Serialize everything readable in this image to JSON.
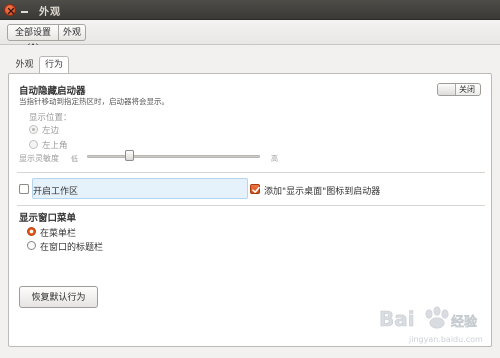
{
  "window": {
    "title": "外观"
  },
  "toolbar": {
    "all_settings_label": "全部设置(A)",
    "current_label": "外观"
  },
  "tabs": [
    {
      "label": "外观",
      "active": false
    },
    {
      "label": "行为",
      "active": true
    }
  ],
  "autohide": {
    "title": "自动隐藏启动器",
    "description": "当指针移动到指定热区时，启动器将会显示。",
    "toggle_label": "关闭",
    "toggle_on": false
  },
  "position": {
    "label": "显示位置：",
    "options": [
      {
        "label": "左边",
        "checked": true
      },
      {
        "label": "左上角",
        "checked": false
      }
    ]
  },
  "sensitivity": {
    "label": "显示灵敏度",
    "low": "低",
    "high": "高",
    "level_fraction": 0.22
  },
  "workspaces": {
    "label": "开启工作区",
    "checked": false
  },
  "show_desktop": {
    "label": "添加\"显示桌面\"图标到启动器",
    "checked": true
  },
  "window_menu": {
    "title": "显示窗口菜单",
    "options": [
      {
        "label": "在菜单栏",
        "checked": true
      },
      {
        "label": "在窗口的标题栏",
        "checked": false
      }
    ]
  },
  "restore_button": {
    "label": "恢复默认行为"
  },
  "watermark": {
    "text": "Baidu经验",
    "domain": "jingyan.baidu.com"
  },
  "colors": {
    "accent": "#e1561f",
    "titlebar": "#3c3b37",
    "highlight": "#e6f2fb"
  },
  "icons": [
    "close-icon",
    "minimize-icon",
    "checkmark-icon",
    "baidu-paw-icon"
  ]
}
